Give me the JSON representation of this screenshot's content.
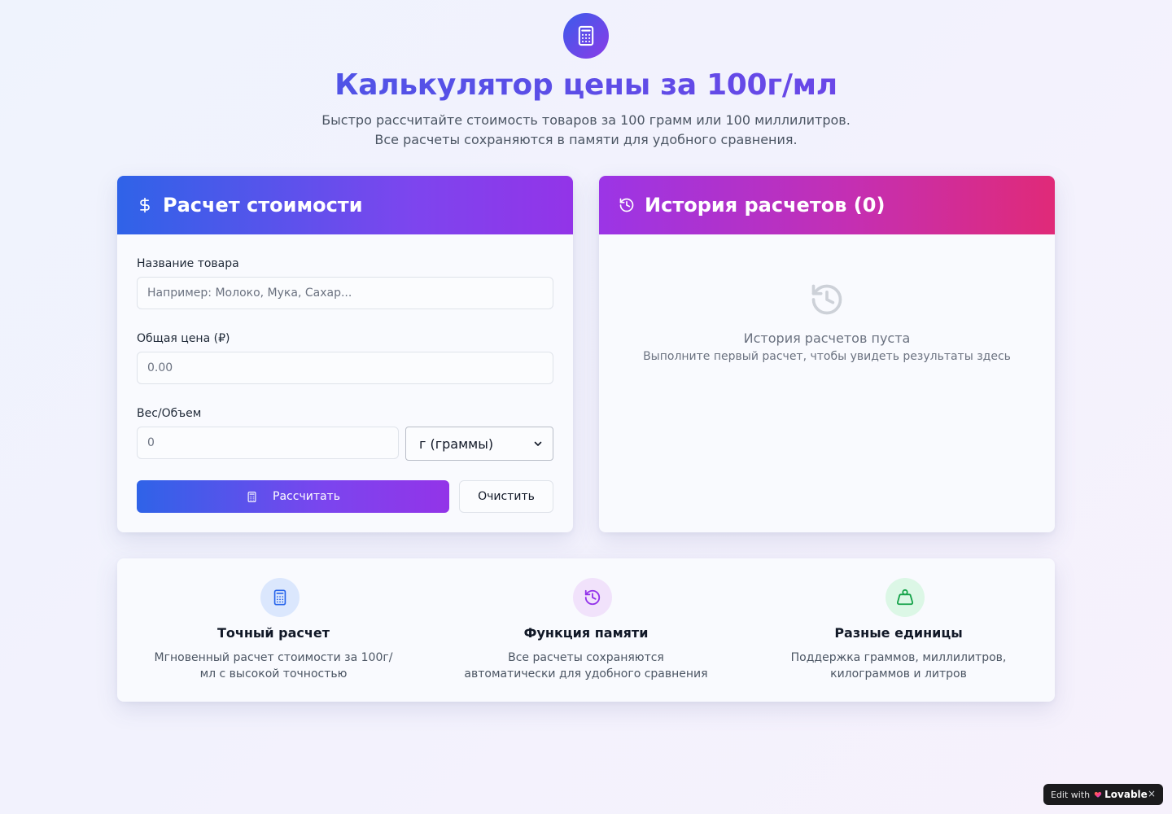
{
  "app": {
    "icon": "calculator-icon",
    "title": "Калькулятор цены за 100г/мл",
    "subtitle": "Быстро рассчитайте стоимость товаров за 100 грамм или 100 миллилитров. Все расчеты сохраняются в памяти для удобного сравнения."
  },
  "calculator": {
    "header_icon": "dollar-icon",
    "header": "Расчет стоимости",
    "name_label": "Название товара",
    "name_placeholder": "Например: Молоко, Мука, Сахар...",
    "price_label": "Общая цена (₽)",
    "price_placeholder": "0.00",
    "weight_label": "Вес/Объем",
    "weight_placeholder": "0",
    "unit_selected": "г (граммы)",
    "calculate_label": "Рассчитать",
    "clear_label": "Очистить"
  },
  "history": {
    "header_icon": "history-icon",
    "header": "История расчетов (0)",
    "empty_title": "История расчетов пуста",
    "empty_subtitle": "Выполните первый расчет, чтобы увидеть результаты здесь"
  },
  "features": [
    {
      "icon": "calculator-icon",
      "title": "Точный расчет",
      "description": "Мгновенный расчет стоимости за 100г/мл с высокой точностью",
      "icon_bg": "#dbe7fd",
      "icon_color": "#2563eb"
    },
    {
      "icon": "history-icon",
      "title": "Функция памяти",
      "description": "Все расчеты сохраняются автоматически для удобного сравнения",
      "icon_bg": "#f1e2fb",
      "icon_color": "#9333ea"
    },
    {
      "icon": "weight-icon",
      "title": "Разные единицы",
      "description": "Поддержка граммов, миллилитров, килограммов и литров",
      "icon_bg": "#dcf7e6",
      "icon_color": "#16a34a"
    }
  ],
  "badge": {
    "prefix": "Edit with",
    "brand": "Lovable",
    "close": "×"
  },
  "colors": {
    "primary_gradient_start": "#2f63e8",
    "primary_gradient_end": "#9334e8",
    "history_gradient_start": "#9b35e6",
    "history_gradient_end": "#e02a78"
  }
}
